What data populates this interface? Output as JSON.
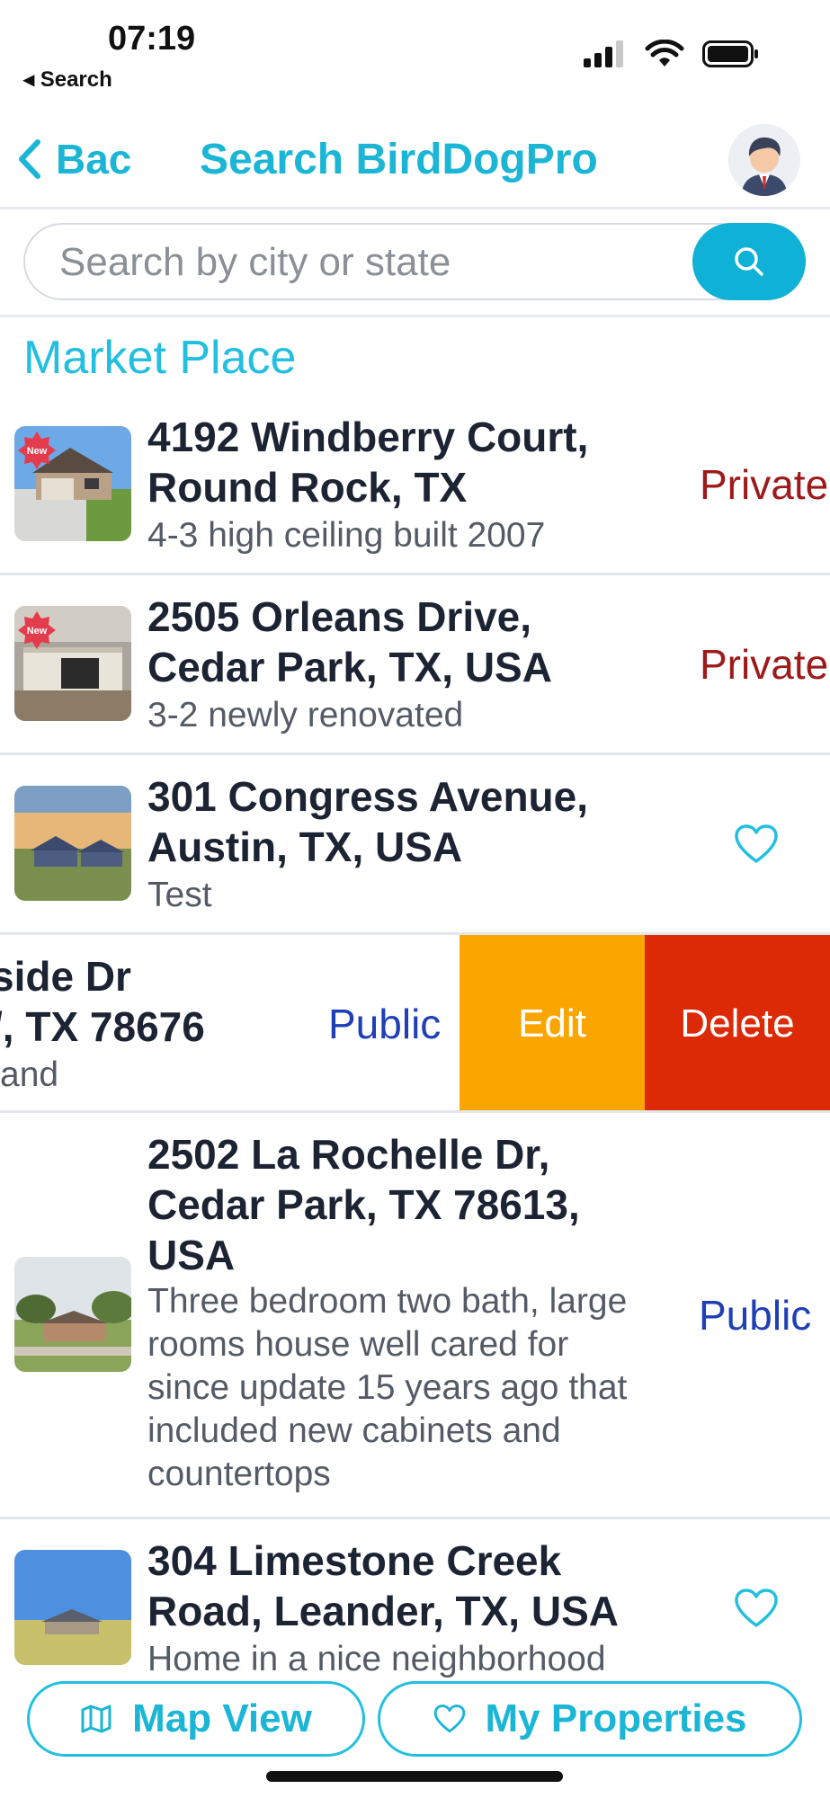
{
  "status": {
    "time": "07:19",
    "back_app": "◂ Search"
  },
  "nav": {
    "back_label": "Bac",
    "title": "Search BirdDogPro"
  },
  "search": {
    "placeholder": "Search by city or state"
  },
  "section_title": "Market Place",
  "listings": [
    {
      "address_line1": "4192 Windberry Court,",
      "address_line2": "Round Rock, TX",
      "description": "4-3 high ceiling built 2007",
      "visibility": "Private",
      "badge": "New"
    },
    {
      "address_line1": "2505 Orleans Drive,",
      "address_line2": "Cedar Park, TX, USA",
      "description": "3-2 newly renovated",
      "visibility": "Private",
      "badge": "New"
    },
    {
      "address_line1": "301 Congress Avenue,",
      "address_line2": "Austin, TX, USA",
      "description": "Test"
    },
    {
      "address_line1": "side Dr",
      "address_line2": "/, TX 78676",
      "description": "and",
      "visibility": "Public",
      "edit_label": "Edit",
      "delete_label": "Delete"
    },
    {
      "address_line1": "2502 La Rochelle Dr,",
      "address_line2": "Cedar Park, TX 78613,",
      "address_line3": "USA",
      "description_lines": [
        "Three bedroom two bath, large",
        "rooms house well cared for",
        "since update 15 years ago that",
        "included new cabinets and",
        "countertops"
      ],
      "visibility": "Public"
    },
    {
      "address_line1": "304 Limestone Creek",
      "address_line2": "Road, Leander, TX, USA",
      "description": "Home in a nice neighborhood"
    }
  ],
  "bottom": {
    "map_view_label": "Map View",
    "my_properties_label": "My Properties"
  },
  "colors": {
    "accent": "#1bb6d6",
    "private": "#9e1a1a",
    "public": "#1f3fb6",
    "edit": "#fba600",
    "delete": "#dc2a06"
  }
}
